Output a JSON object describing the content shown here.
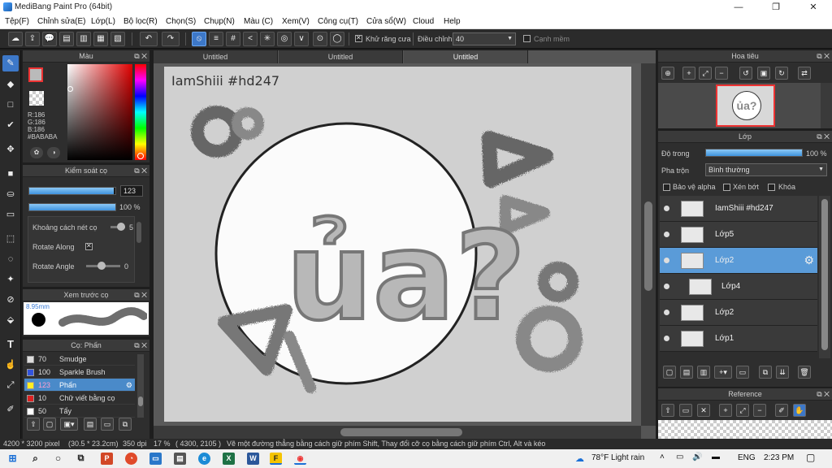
{
  "window": {
    "title": "MediBang Paint Pro (64bit)",
    "minimize": "—",
    "maximize": "❐",
    "close": "✕"
  },
  "menu": [
    "Tệp(F)",
    "Chỉnh sửa(E)",
    "Lớp(L)",
    "Bộ lọc(R)",
    "Chọn(S)",
    "Chụp(N)",
    "Màu (C)",
    "Xem(V)",
    "Công cụ(T)",
    "Cửa sổ(W)",
    "Cloud",
    "Help"
  ],
  "toolbar": {
    "antialias_label": "Khử răng cưa",
    "adjust_label": "Điều chỉnh",
    "adjust_value": "40",
    "edge_label": "Cạnh mềm",
    "antialias_checked": true
  },
  "color_panel": {
    "title": "Màu",
    "r": "R:186",
    "g": "G:186",
    "b": "B:186",
    "hex": "#BABABA"
  },
  "brush_control": {
    "title": "Kiểm soát cọ",
    "size_value": "123",
    "size_fraction": 0.98,
    "opacity_value": "100 %",
    "opacity_fraction": 1.0,
    "spacing_label": "Khoảng cách nét cọ",
    "spacing_value": "5",
    "rotate_along_label": "Rotate Along",
    "rotate_angle_label": "Rotate Angle",
    "rotate_angle_value": "0"
  },
  "brush_preview": {
    "title": "Xem trước cọ",
    "size": "8.95mm"
  },
  "brush_list": {
    "title": "Cọ: Phấn",
    "items": [
      {
        "num": "70",
        "name": "Smudge",
        "color": "#dddddd"
      },
      {
        "num": "100",
        "name": "Sparkle Brush",
        "color": "#3355dd"
      },
      {
        "num": "123",
        "name": "Phấn",
        "color": "#ffee22",
        "selected": true
      },
      {
        "num": "10",
        "name": "Chữ viết bằng cọ",
        "color": "#dd2222"
      },
      {
        "num": "50",
        "name": "Tẩy",
        "color": "#ffffff"
      }
    ]
  },
  "doc_tabs": [
    "Untitled",
    "Untitled",
    "Untitled"
  ],
  "canvas": {
    "watermark": "IamShiii #hd247",
    "artwork_text": "ủa?"
  },
  "navigator": {
    "title": "Hoa tiêu"
  },
  "layer_panel": {
    "title": "Lớp",
    "opacity_label": "Độ trong",
    "opacity_value": "100 %",
    "opacity_fraction": 1.0,
    "blend_label": "Pha trộn",
    "blend_value": "Bình thường",
    "protect_alpha": "Bảo vệ alpha",
    "clip": "Xén bớt",
    "lock": "Khóa",
    "layers": [
      {
        "name": "IamShiii #hd247",
        "selected": false,
        "indent": false
      },
      {
        "name": "Lớp5",
        "selected": false,
        "indent": false
      },
      {
        "name": "Lớp2",
        "selected": true,
        "indent": false
      },
      {
        "name": "Lớp4",
        "selected": false,
        "indent": true
      },
      {
        "name": "Lớp2",
        "selected": false,
        "indent": false
      },
      {
        "name": "Lớp1",
        "selected": false,
        "indent": false
      }
    ]
  },
  "reference_panel": {
    "title": "Reference"
  },
  "status": {
    "dimensions": "4200 * 3200 pixel",
    "size_cm": "(30.5 * 23.2cm)",
    "dpi": "350 dpi",
    "zoom": "17 %",
    "coords": "( 4300, 2105 )",
    "hint": "Vẽ một đường thẳng bằng cách giữ phím Shift, Thay đổi cỡ cọ bằng cách giữ phím Ctrl, Alt và kéo"
  },
  "taskbar": {
    "weather": "78°F  Light rain",
    "lang": "ENG",
    "time": "2:23 PM"
  }
}
